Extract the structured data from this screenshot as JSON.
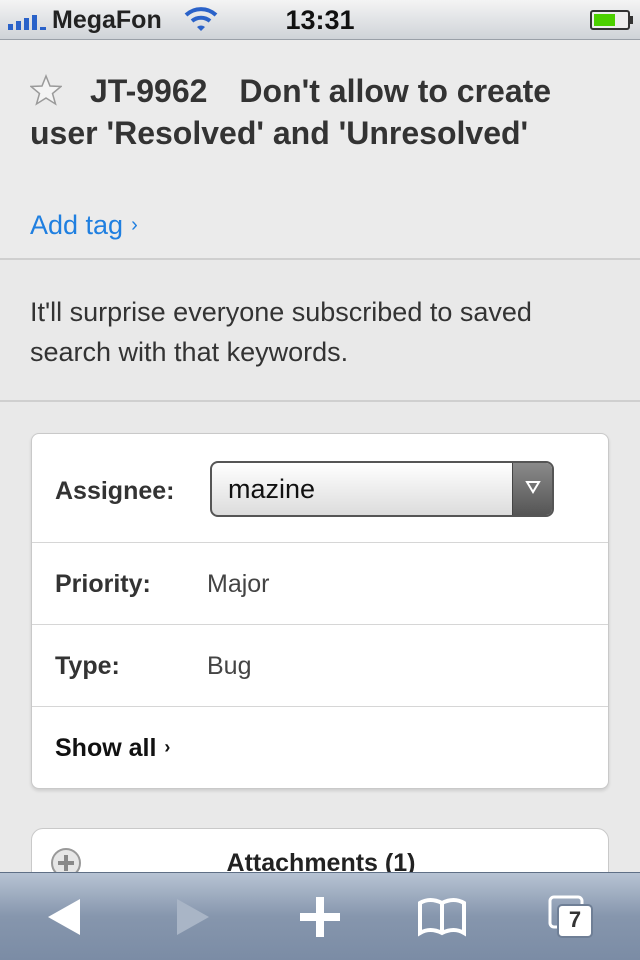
{
  "status_bar": {
    "carrier": "MegaFon",
    "time": "13:31"
  },
  "issue": {
    "id": "JT-9962",
    "title": "Don't allow to create user 'Resolved' and 'Unresolved'",
    "add_tag_label": "Add tag",
    "description": "It'll surprise everyone subscribed to saved search with that keywords."
  },
  "fields": {
    "assignee_label": "Assignee:",
    "assignee_value": "mazine",
    "priority_label": "Priority:",
    "priority_value": "Major",
    "type_label": "Type:",
    "type_value": "Bug",
    "show_all_label": "Show all"
  },
  "attachments": {
    "label": "Attachments (1)"
  },
  "toolbar": {
    "tabs_count": "7",
    "icons": [
      "back-icon",
      "forward-icon",
      "add-icon",
      "bookmarks-icon",
      "tabs-icon"
    ]
  },
  "colors": {
    "link": "#1f7fe0",
    "battery": "#4cd000"
  }
}
